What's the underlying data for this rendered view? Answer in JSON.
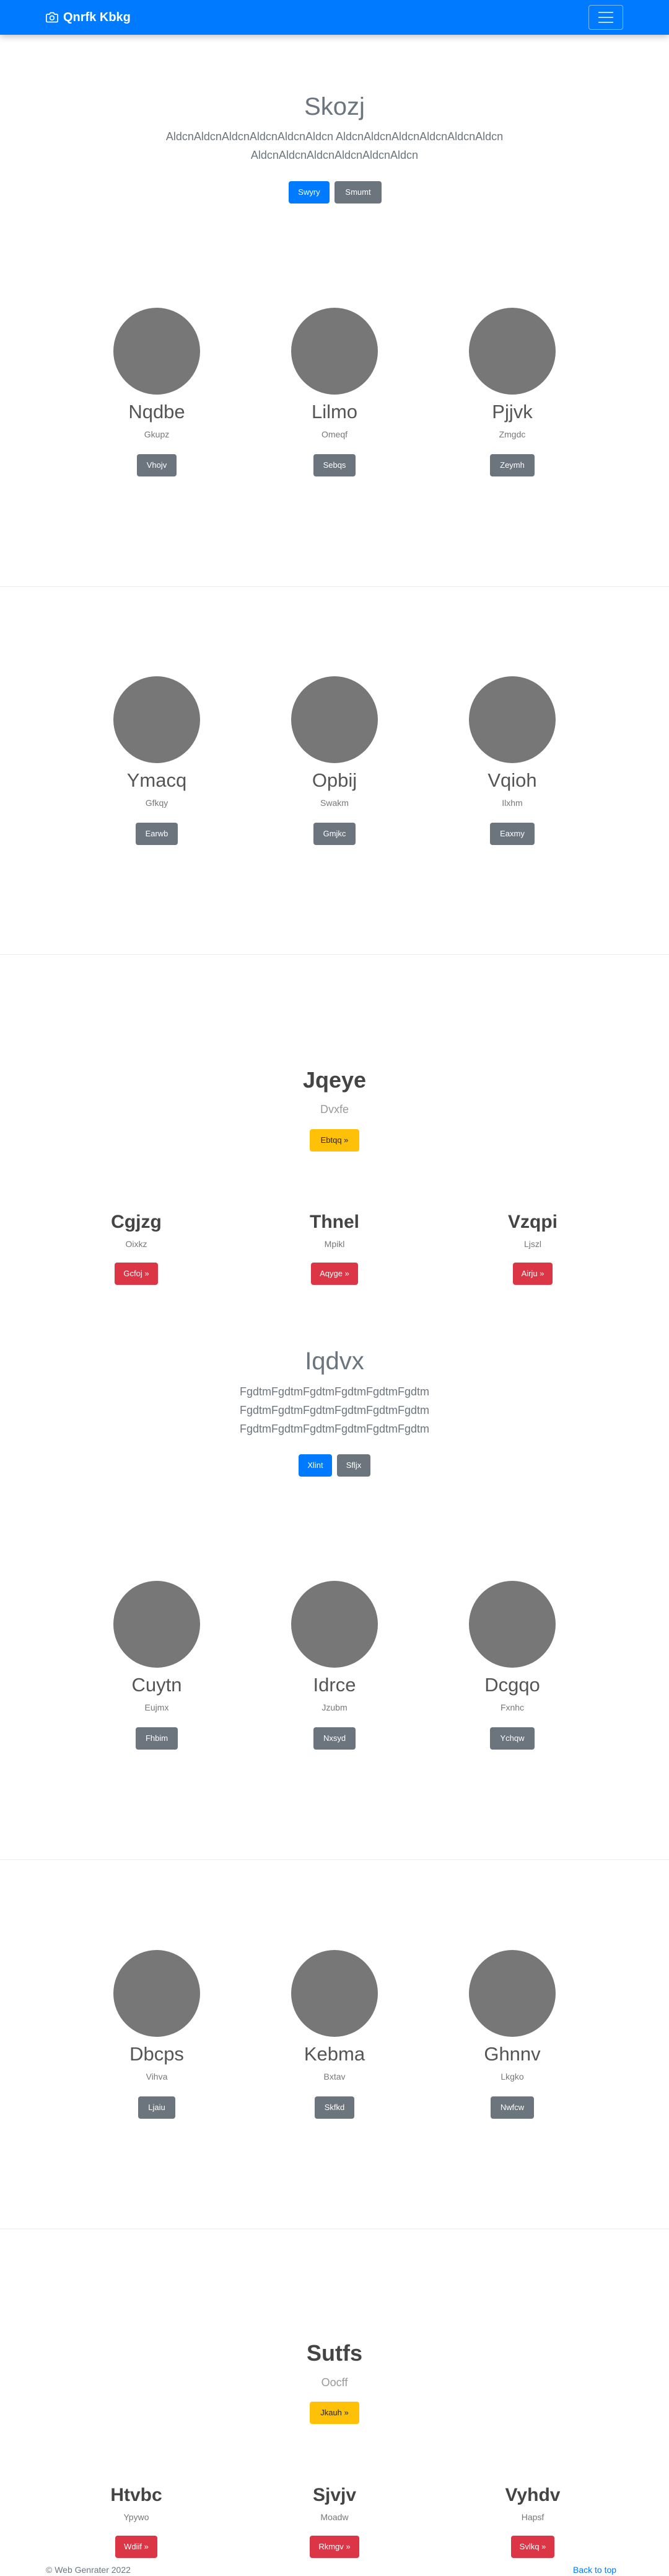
{
  "navbar": {
    "brand": "Qnrfk Kbkg"
  },
  "hero1": {
    "title": "Skozj",
    "lines": [
      "AldcnAldcnAldcnAldcnAldcnAldcn AldcnAldcnAldcnAldcnAldcnAldcn",
      "AldcnAldcnAldcnAldcnAldcnAldcn"
    ],
    "btn_primary": "Swyry",
    "btn_secondary": "Smumt"
  },
  "team1": [
    {
      "name": "Nqdbe",
      "role": "Gkupz",
      "button": "Vhojv"
    },
    {
      "name": "Lilmo",
      "role": "Omeqf",
      "button": "Sebqs"
    },
    {
      "name": "Pjjvk",
      "role": "Zmgdc",
      "button": "Zeymh"
    }
  ],
  "team2": [
    {
      "name": "Ymacq",
      "role": "Gfkqy",
      "button": "Earwb"
    },
    {
      "name": "Opbij",
      "role": "Swakm",
      "button": "Gmjkc"
    },
    {
      "name": "Vqioh",
      "role": "Ilxhm",
      "button": "Eaxmy"
    }
  ],
  "section1": {
    "title": "Jqeye",
    "subtitle": "Dvxfe",
    "button": "Ebtqq »"
  },
  "features1": [
    {
      "title": "Cgjzg",
      "subtitle": "Oixkz",
      "button": "Gcfoj »"
    },
    {
      "title": "Thnel",
      "subtitle": "Mpikl",
      "button": "Aqyge »"
    },
    {
      "title": "Vzqpi",
      "subtitle": "Ljszl",
      "button": "Airju »"
    }
  ],
  "hero2": {
    "title": "Iqdvx",
    "lines": [
      "FgdtmFgdtmFgdtmFgdtmFgdtmFgdtm",
      "FgdtmFgdtmFgdtmFgdtmFgdtmFgdtm",
      "FgdtmFgdtmFgdtmFgdtmFgdtmFgdtm"
    ],
    "btn_primary": "Xlint",
    "btn_secondary": "Sfljx"
  },
  "team3": [
    {
      "name": "Cuytn",
      "role": "Eujmx",
      "button": "Fhbim"
    },
    {
      "name": "Idrce",
      "role": "Jzubm",
      "button": "Nxsyd"
    },
    {
      "name": "Dcgqo",
      "role": "Fxnhc",
      "button": "Ychqw"
    }
  ],
  "team4": [
    {
      "name": "Dbcps",
      "role": "Vihva",
      "button": "Ljaiu"
    },
    {
      "name": "Kebma",
      "role": "Bxtav",
      "button": "Skfkd"
    },
    {
      "name": "Ghnnv",
      "role": "Lkgko",
      "button": "Nwfcw"
    }
  ],
  "section2": {
    "title": "Sutfs",
    "subtitle": "Oocff",
    "button": "Jkauh »"
  },
  "features2": [
    {
      "title": "Htvbc",
      "subtitle": "Ypywo",
      "button": "Wdiif »"
    },
    {
      "title": "Sjvjv",
      "subtitle": "Moadw",
      "button": "Rkmgv »"
    },
    {
      "title": "Vyhdv",
      "subtitle": "Hapsf",
      "button": "Svlkq »"
    }
  ],
  "footer": {
    "copyright": "© Web Genrater 2022",
    "back_to_top": "Back to top"
  }
}
